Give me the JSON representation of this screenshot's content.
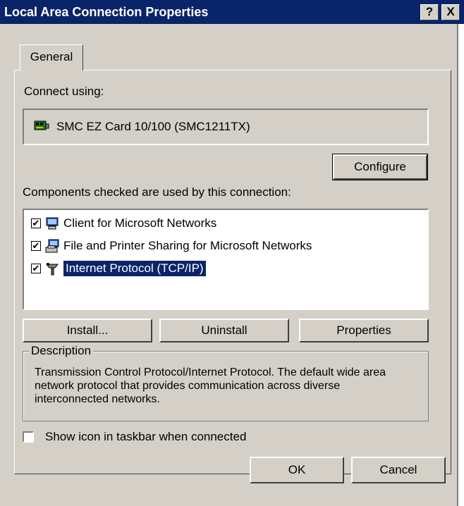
{
  "window": {
    "title": "Local Area Connection Properties",
    "help_label": "?",
    "close_label": "X"
  },
  "tabs": [
    {
      "label": "General",
      "selected": true
    }
  ],
  "connect_using": {
    "label": "Connect using:",
    "adapter": "SMC EZ Card 10/100 (SMC1211TX)",
    "configure_label": "Configure"
  },
  "components": {
    "label": "Components checked are used by this connection:",
    "items": [
      {
        "label": "Client for Microsoft Networks",
        "checked": true,
        "icon": "network-client-icon",
        "selected": false
      },
      {
        "label": "File and Printer Sharing for Microsoft Networks",
        "checked": true,
        "icon": "file-printer-sharing-icon",
        "selected": false
      },
      {
        "label": "Internet Protocol (TCP/IP)",
        "checked": true,
        "icon": "protocol-icon",
        "selected": true
      }
    ],
    "install_label": "Install...",
    "uninstall_label": "Uninstall",
    "properties_label": "Properties"
  },
  "description": {
    "title": "Description",
    "text": "Transmission Control Protocol/Internet Protocol. The default wide area network protocol that provides communication across diverse interconnected networks."
  },
  "show_icon": {
    "label": "Show icon in taskbar when connected",
    "checked": false
  },
  "footer": {
    "ok_label": "OK",
    "cancel_label": "Cancel"
  },
  "colors": {
    "titlebar": "#0a246a",
    "face": "#d4d0c8",
    "selection": "#0a246a"
  }
}
